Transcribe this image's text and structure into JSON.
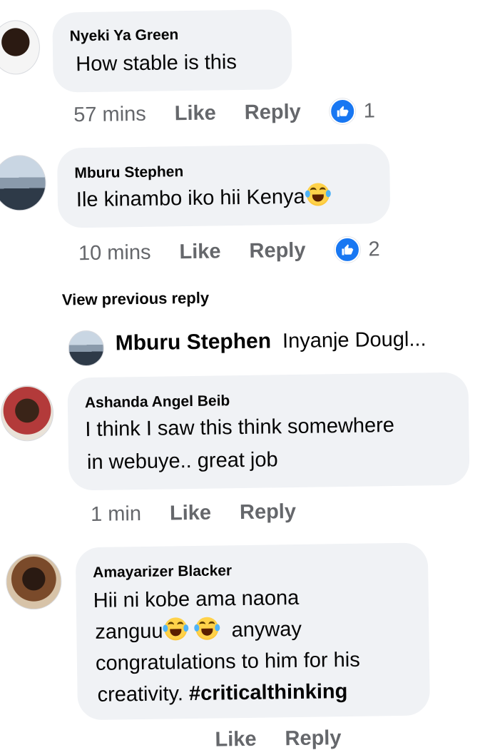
{
  "comments": [
    {
      "author": "Nyeki Ya Green",
      "text_lines": [
        "How stable is this"
      ],
      "time": "57 mins",
      "like_label": "Like",
      "reply_label": "Reply",
      "reactions": "1"
    },
    {
      "author": "Mburu Stephen",
      "text_lines": [
        "Ile kinambo iko hii Kenya"
      ],
      "time": "10 mins",
      "like_label": "Like",
      "reply_label": "Reply",
      "reactions": "2"
    },
    {
      "author": "Ashanda Angel Beib",
      "text_lines": [
        "I think I saw this think somewhere",
        "in webuye.. great job"
      ],
      "time": "1 min",
      "like_label": "Like",
      "reply_label": "Reply"
    },
    {
      "author": "Amayarizer Blacker",
      "text_lines": [
        "Hii ni kobe ama naona",
        "zanguu",
        "anyway",
        "congratulations to him for his",
        "creativity."
      ],
      "hashtag": "#criticalthinking",
      "like_label": "Like",
      "reply_label": "Reply"
    }
  ],
  "view_previous": "View previous reply",
  "reply_preview": {
    "author": "Mburu Stephen",
    "text": "Inyanje Dougl..."
  },
  "icons": {
    "like_badge": "thumbs-up-icon",
    "emoji": "laughing-tears-emoji"
  },
  "colors": {
    "bubble": "#f0f2f5",
    "meta": "#65676b",
    "like_blue": "#1877f2"
  }
}
